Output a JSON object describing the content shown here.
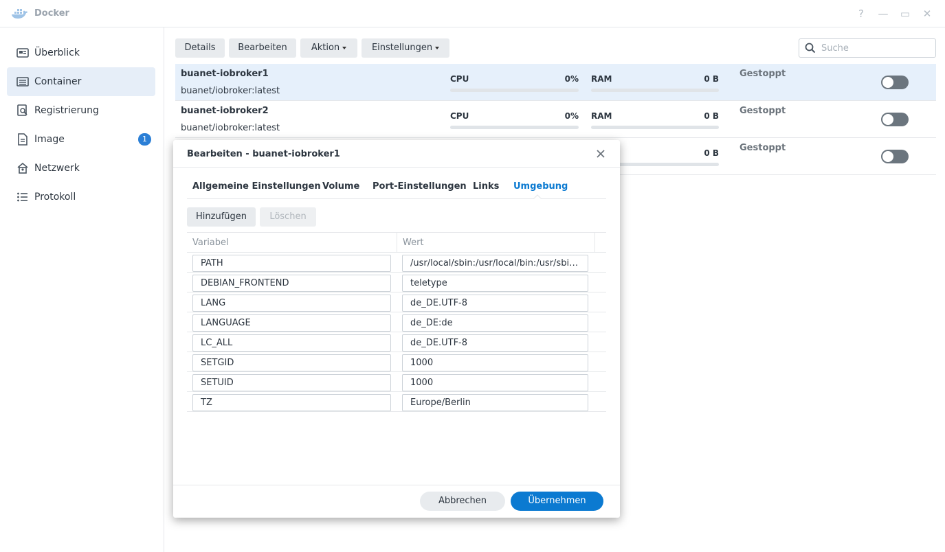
{
  "window": {
    "title": "Docker",
    "help": "?",
    "minimize": "—",
    "maximize": "▭",
    "close": "✕"
  },
  "sidebar": {
    "items": [
      {
        "label": "Überblick",
        "icon": "overview-icon"
      },
      {
        "label": "Container",
        "icon": "container-icon",
        "active": true
      },
      {
        "label": "Registrierung",
        "icon": "registry-icon"
      },
      {
        "label": "Image",
        "icon": "image-icon",
        "badge": "1"
      },
      {
        "label": "Netzwerk",
        "icon": "network-icon"
      },
      {
        "label": "Protokoll",
        "icon": "log-icon"
      }
    ]
  },
  "toolbar": {
    "details": "Details",
    "bearbeiten": "Bearbeiten",
    "aktion": "Aktion",
    "einstellungen": "Einstellungen",
    "search_placeholder": "Suche"
  },
  "containers": [
    {
      "name": "buanet-iobroker1",
      "image": "buanet/iobroker:latest",
      "cpu_label": "CPU",
      "cpu": "0%",
      "ram_label": "RAM",
      "ram": "0 B",
      "status": "Gestoppt"
    },
    {
      "name": "buanet-iobroker2",
      "image": "buanet/iobroker:latest",
      "cpu_label": "CPU",
      "cpu": "0%",
      "ram_label": "RAM",
      "ram": "0 B",
      "status": "Gestoppt"
    },
    {
      "ram": "0 B",
      "status": "Gestoppt"
    }
  ],
  "modal": {
    "title": "Bearbeiten - buanet-iobroker1",
    "tabs": [
      "Allgemeine Einstellungen",
      "Volume",
      "Port-Einstellungen",
      "Links",
      "Umgebung"
    ],
    "active_tab": "Umgebung",
    "add": "Hinzufügen",
    "delete": "Löschen",
    "col_variable": "Variabel",
    "col_value": "Wert",
    "env": [
      {
        "key": "PATH",
        "value": "/usr/local/sbin:/usr/local/bin:/usr/sbin:/usr/bin:/sbin:/bin"
      },
      {
        "key": "DEBIAN_FRONTEND",
        "value": "teletype"
      },
      {
        "key": "LANG",
        "value": "de_DE.UTF-8"
      },
      {
        "key": "LANGUAGE",
        "value": "de_DE:de"
      },
      {
        "key": "LC_ALL",
        "value": "de_DE.UTF-8"
      },
      {
        "key": "SETGID",
        "value": "1000"
      },
      {
        "key": "SETUID",
        "value": "1000"
      },
      {
        "key": "TZ",
        "value": "Europe/Berlin"
      }
    ],
    "cancel": "Abbrechen",
    "apply": "Übernehmen"
  },
  "colors": {
    "accent": "#0b7ad1",
    "selected_row": "#e6f0fb",
    "toggle_off": "#6b757e"
  }
}
